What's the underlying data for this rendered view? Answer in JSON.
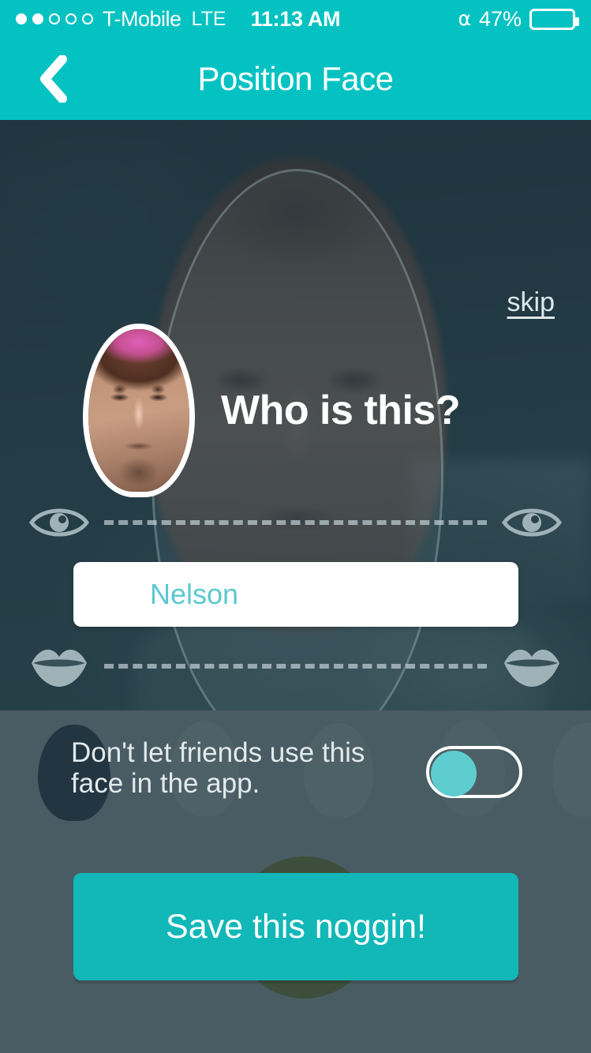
{
  "status_bar": {
    "signal_dots_total": 5,
    "signal_dots_filled": 2,
    "carrier": "T-Mobile",
    "network": "LTE",
    "time": "11:13 AM",
    "bluetooth_icon": "bluetooth-icon",
    "battery_percent": "47%",
    "battery_level": 47
  },
  "nav_bar": {
    "back_icon": "chevron-left-icon",
    "title": "Position Face"
  },
  "photo_area": {
    "skip_label": "skip",
    "heading": "Who is this?",
    "face_thumbnail": "face-thumbnail",
    "face_guide_oval": "face-position-guide",
    "eye_icon_left": "eye-icon",
    "eye_icon_right": "eye-icon",
    "mouth_icon_left": "lips-icon",
    "mouth_icon_right": "lips-icon",
    "name_field": {
      "value": "Nelson",
      "placeholder": "Nelson"
    }
  },
  "bottom_panel": {
    "privacy_label": "Don't let friends use this face in the app.",
    "toggle_state": "off",
    "save_label": "Save this noggin!"
  },
  "colors": {
    "accent_teal": "#04c2c2",
    "button_teal": "#12b8b8",
    "toggle_knob_teal": "#5ecdd0",
    "input_text_teal": "#5cc8cf",
    "dark_backdrop": "#213640",
    "bottom_panel": "#4a5c63",
    "white": "#ffffff"
  }
}
